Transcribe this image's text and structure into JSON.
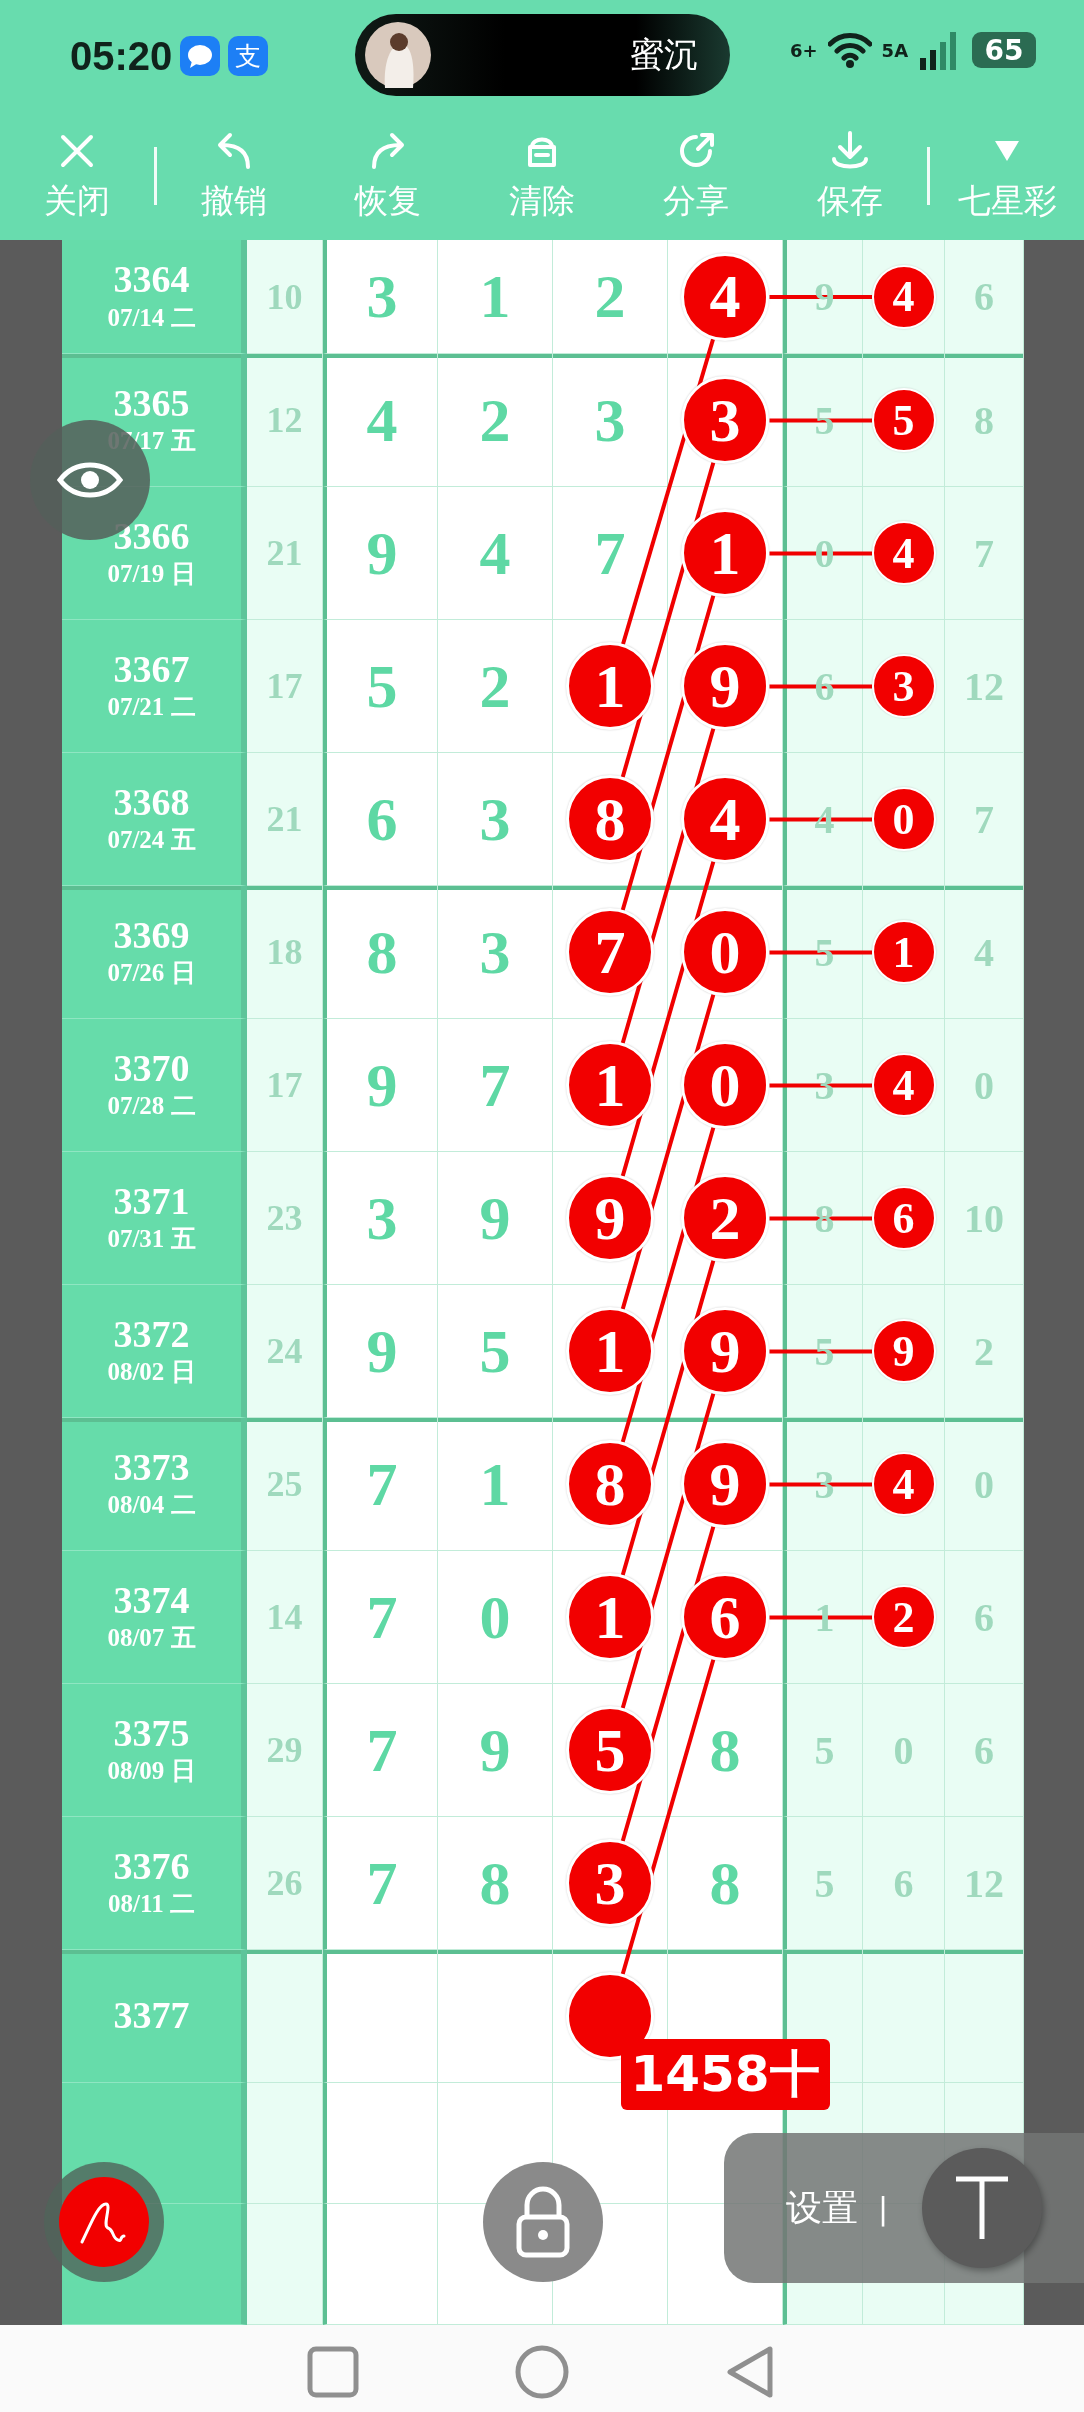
{
  "status_bar": {
    "time": "05:20",
    "apps": [
      {
        "kind": "message"
      },
      {
        "kind": "pay",
        "text": "支"
      }
    ],
    "island_text": "蜜沉",
    "wifi_text": "6+",
    "signal_text": "5A",
    "battery": "65"
  },
  "toolbar": [
    {
      "kind": "close",
      "label": "关闭"
    },
    {
      "kind": "undo",
      "label": "撤销"
    },
    {
      "kind": "redo",
      "label": "恢复"
    },
    {
      "kind": "clear",
      "label": "清除"
    },
    {
      "kind": "share",
      "label": "分享"
    },
    {
      "kind": "save",
      "label": "保存"
    },
    {
      "kind": "menu",
      "label": "七星彩"
    }
  ],
  "rows": [
    {
      "issue": "3364",
      "date": "07/14 二",
      "group_start": false,
      "sum": "10",
      "digits": [
        {
          "v": "3",
          "circled": false
        },
        {
          "v": "1",
          "circled": false
        },
        {
          "v": "2",
          "circled": false
        },
        {
          "v": "4",
          "circled": true
        }
      ],
      "tail": [
        {
          "v": "9",
          "circled": false
        },
        {
          "v": "4",
          "circled": true
        },
        {
          "v": "6",
          "circled": false
        }
      ]
    },
    {
      "issue": "3365",
      "date": "07/17 五",
      "group_start": true,
      "sum": "12",
      "digits": [
        {
          "v": "4",
          "circled": false
        },
        {
          "v": "2",
          "circled": false
        },
        {
          "v": "3",
          "circled": false
        },
        {
          "v": "3",
          "circled": true
        }
      ],
      "tail": [
        {
          "v": "5",
          "circled": false
        },
        {
          "v": "5",
          "circled": true
        },
        {
          "v": "8",
          "circled": false
        }
      ]
    },
    {
      "issue": "3366",
      "date": "07/19 日",
      "group_start": false,
      "sum": "21",
      "digits": [
        {
          "v": "9",
          "circled": false
        },
        {
          "v": "4",
          "circled": false
        },
        {
          "v": "7",
          "circled": false
        },
        {
          "v": "1",
          "circled": true
        }
      ],
      "tail": [
        {
          "v": "0",
          "circled": false
        },
        {
          "v": "4",
          "circled": true
        },
        {
          "v": "7",
          "circled": false
        }
      ]
    },
    {
      "issue": "3367",
      "date": "07/21 二",
      "group_start": false,
      "sum": "17",
      "digits": [
        {
          "v": "5",
          "circled": false
        },
        {
          "v": "2",
          "circled": false
        },
        {
          "v": "1",
          "circled": true
        },
        {
          "v": "9",
          "circled": true
        }
      ],
      "tail": [
        {
          "v": "6",
          "circled": false
        },
        {
          "v": "3",
          "circled": true
        },
        {
          "v": "12",
          "circled": false
        }
      ]
    },
    {
      "issue": "3368",
      "date": "07/24 五",
      "group_start": false,
      "sum": "21",
      "digits": [
        {
          "v": "6",
          "circled": false
        },
        {
          "v": "3",
          "circled": false
        },
        {
          "v": "8",
          "circled": true
        },
        {
          "v": "4",
          "circled": true
        }
      ],
      "tail": [
        {
          "v": "4",
          "circled": false
        },
        {
          "v": "0",
          "circled": true
        },
        {
          "v": "7",
          "circled": false
        }
      ]
    },
    {
      "issue": "3369",
      "date": "07/26 日",
      "group_start": true,
      "sum": "18",
      "digits": [
        {
          "v": "8",
          "circled": false
        },
        {
          "v": "3",
          "circled": false
        },
        {
          "v": "7",
          "circled": true
        },
        {
          "v": "0",
          "circled": true
        }
      ],
      "tail": [
        {
          "v": "5",
          "circled": false
        },
        {
          "v": "1",
          "circled": true
        },
        {
          "v": "4",
          "circled": false
        }
      ]
    },
    {
      "issue": "3370",
      "date": "07/28 二",
      "group_start": false,
      "sum": "17",
      "digits": [
        {
          "v": "9",
          "circled": false
        },
        {
          "v": "7",
          "circled": false
        },
        {
          "v": "1",
          "circled": true
        },
        {
          "v": "0",
          "circled": true
        }
      ],
      "tail": [
        {
          "v": "3",
          "circled": false
        },
        {
          "v": "4",
          "circled": true
        },
        {
          "v": "0",
          "circled": false
        }
      ]
    },
    {
      "issue": "3371",
      "date": "07/31 五",
      "group_start": false,
      "sum": "23",
      "digits": [
        {
          "v": "3",
          "circled": false
        },
        {
          "v": "9",
          "circled": false
        },
        {
          "v": "9",
          "circled": true
        },
        {
          "v": "2",
          "circled": true
        }
      ],
      "tail": [
        {
          "v": "8",
          "circled": false
        },
        {
          "v": "6",
          "circled": true
        },
        {
          "v": "10",
          "circled": false
        }
      ]
    },
    {
      "issue": "3372",
      "date": "08/02 日",
      "group_start": false,
      "sum": "24",
      "digits": [
        {
          "v": "9",
          "circled": false
        },
        {
          "v": "5",
          "circled": false
        },
        {
          "v": "1",
          "circled": true
        },
        {
          "v": "9",
          "circled": true
        }
      ],
      "tail": [
        {
          "v": "5",
          "circled": false
        },
        {
          "v": "9",
          "circled": true
        },
        {
          "v": "2",
          "circled": false
        }
      ]
    },
    {
      "issue": "3373",
      "date": "08/04 二",
      "group_start": true,
      "sum": "25",
      "digits": [
        {
          "v": "7",
          "circled": false
        },
        {
          "v": "1",
          "circled": false
        },
        {
          "v": "8",
          "circled": true
        },
        {
          "v": "9",
          "circled": true
        }
      ],
      "tail": [
        {
          "v": "3",
          "circled": false
        },
        {
          "v": "4",
          "circled": true
        },
        {
          "v": "0",
          "circled": false
        }
      ]
    },
    {
      "issue": "3374",
      "date": "08/07 五",
      "group_start": false,
      "sum": "14",
      "digits": [
        {
          "v": "7",
          "circled": false
        },
        {
          "v": "0",
          "circled": false
        },
        {
          "v": "1",
          "circled": true
        },
        {
          "v": "6",
          "circled": true
        }
      ],
      "tail": [
        {
          "v": "1",
          "circled": false
        },
        {
          "v": "2",
          "circled": true
        },
        {
          "v": "6",
          "circled": false
        }
      ]
    },
    {
      "issue": "3375",
      "date": "08/09 日",
      "group_start": false,
      "sum": "29",
      "digits": [
        {
          "v": "7",
          "circled": false
        },
        {
          "v": "9",
          "circled": false
        },
        {
          "v": "5",
          "circled": true
        },
        {
          "v": "8",
          "circled": false
        }
      ],
      "tail": [
        {
          "v": "5",
          "circled": false
        },
        {
          "v": "0",
          "circled": false
        },
        {
          "v": "6",
          "circled": false
        }
      ]
    },
    {
      "issue": "3376",
      "date": "08/11 二",
      "group_start": false,
      "sum": "26",
      "digits": [
        {
          "v": "7",
          "circled": false
        },
        {
          "v": "8",
          "circled": false
        },
        {
          "v": "3",
          "circled": true
        },
        {
          "v": "8",
          "circled": false
        }
      ],
      "tail": [
        {
          "v": "5",
          "circled": false
        },
        {
          "v": "6",
          "circled": false
        },
        {
          "v": "12",
          "circled": false
        }
      ]
    },
    {
      "issue": "3377",
      "group_start": true,
      "tag": "1458十",
      "digits": [
        {
          "circled": false
        },
        {
          "circled": false
        },
        {
          "circled": true
        },
        {
          "circled": false
        }
      ],
      "tail": [
        {
          "circled": false
        },
        {
          "circled": false
        },
        {
          "circled": false
        }
      ]
    }
  ],
  "settings_label": "设置",
  "settings_separator": "|"
}
